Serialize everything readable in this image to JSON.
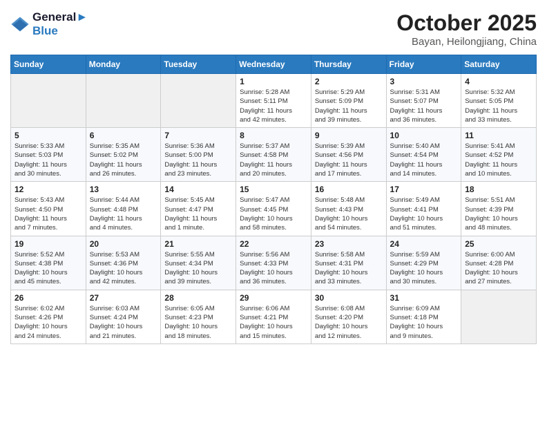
{
  "logo": {
    "line1": "General",
    "line2": "Blue"
  },
  "title": "October 2025",
  "subtitle": "Bayan, Heilongjiang, China",
  "days_header": [
    "Sunday",
    "Monday",
    "Tuesday",
    "Wednesday",
    "Thursday",
    "Friday",
    "Saturday"
  ],
  "weeks": [
    [
      {
        "day": "",
        "info": ""
      },
      {
        "day": "",
        "info": ""
      },
      {
        "day": "",
        "info": ""
      },
      {
        "day": "1",
        "info": "Sunrise: 5:28 AM\nSunset: 5:11 PM\nDaylight: 11 hours\nand 42 minutes."
      },
      {
        "day": "2",
        "info": "Sunrise: 5:29 AM\nSunset: 5:09 PM\nDaylight: 11 hours\nand 39 minutes."
      },
      {
        "day": "3",
        "info": "Sunrise: 5:31 AM\nSunset: 5:07 PM\nDaylight: 11 hours\nand 36 minutes."
      },
      {
        "day": "4",
        "info": "Sunrise: 5:32 AM\nSunset: 5:05 PM\nDaylight: 11 hours\nand 33 minutes."
      }
    ],
    [
      {
        "day": "5",
        "info": "Sunrise: 5:33 AM\nSunset: 5:03 PM\nDaylight: 11 hours\nand 30 minutes."
      },
      {
        "day": "6",
        "info": "Sunrise: 5:35 AM\nSunset: 5:02 PM\nDaylight: 11 hours\nand 26 minutes."
      },
      {
        "day": "7",
        "info": "Sunrise: 5:36 AM\nSunset: 5:00 PM\nDaylight: 11 hours\nand 23 minutes."
      },
      {
        "day": "8",
        "info": "Sunrise: 5:37 AM\nSunset: 4:58 PM\nDaylight: 11 hours\nand 20 minutes."
      },
      {
        "day": "9",
        "info": "Sunrise: 5:39 AM\nSunset: 4:56 PM\nDaylight: 11 hours\nand 17 minutes."
      },
      {
        "day": "10",
        "info": "Sunrise: 5:40 AM\nSunset: 4:54 PM\nDaylight: 11 hours\nand 14 minutes."
      },
      {
        "day": "11",
        "info": "Sunrise: 5:41 AM\nSunset: 4:52 PM\nDaylight: 11 hours\nand 10 minutes."
      }
    ],
    [
      {
        "day": "12",
        "info": "Sunrise: 5:43 AM\nSunset: 4:50 PM\nDaylight: 11 hours\nand 7 minutes."
      },
      {
        "day": "13",
        "info": "Sunrise: 5:44 AM\nSunset: 4:48 PM\nDaylight: 11 hours\nand 4 minutes."
      },
      {
        "day": "14",
        "info": "Sunrise: 5:45 AM\nSunset: 4:47 PM\nDaylight: 11 hours\nand 1 minute."
      },
      {
        "day": "15",
        "info": "Sunrise: 5:47 AM\nSunset: 4:45 PM\nDaylight: 10 hours\nand 58 minutes."
      },
      {
        "day": "16",
        "info": "Sunrise: 5:48 AM\nSunset: 4:43 PM\nDaylight: 10 hours\nand 54 minutes."
      },
      {
        "day": "17",
        "info": "Sunrise: 5:49 AM\nSunset: 4:41 PM\nDaylight: 10 hours\nand 51 minutes."
      },
      {
        "day": "18",
        "info": "Sunrise: 5:51 AM\nSunset: 4:39 PM\nDaylight: 10 hours\nand 48 minutes."
      }
    ],
    [
      {
        "day": "19",
        "info": "Sunrise: 5:52 AM\nSunset: 4:38 PM\nDaylight: 10 hours\nand 45 minutes."
      },
      {
        "day": "20",
        "info": "Sunrise: 5:53 AM\nSunset: 4:36 PM\nDaylight: 10 hours\nand 42 minutes."
      },
      {
        "day": "21",
        "info": "Sunrise: 5:55 AM\nSunset: 4:34 PM\nDaylight: 10 hours\nand 39 minutes."
      },
      {
        "day": "22",
        "info": "Sunrise: 5:56 AM\nSunset: 4:33 PM\nDaylight: 10 hours\nand 36 minutes."
      },
      {
        "day": "23",
        "info": "Sunrise: 5:58 AM\nSunset: 4:31 PM\nDaylight: 10 hours\nand 33 minutes."
      },
      {
        "day": "24",
        "info": "Sunrise: 5:59 AM\nSunset: 4:29 PM\nDaylight: 10 hours\nand 30 minutes."
      },
      {
        "day": "25",
        "info": "Sunrise: 6:00 AM\nSunset: 4:28 PM\nDaylight: 10 hours\nand 27 minutes."
      }
    ],
    [
      {
        "day": "26",
        "info": "Sunrise: 6:02 AM\nSunset: 4:26 PM\nDaylight: 10 hours\nand 24 minutes."
      },
      {
        "day": "27",
        "info": "Sunrise: 6:03 AM\nSunset: 4:24 PM\nDaylight: 10 hours\nand 21 minutes."
      },
      {
        "day": "28",
        "info": "Sunrise: 6:05 AM\nSunset: 4:23 PM\nDaylight: 10 hours\nand 18 minutes."
      },
      {
        "day": "29",
        "info": "Sunrise: 6:06 AM\nSunset: 4:21 PM\nDaylight: 10 hours\nand 15 minutes."
      },
      {
        "day": "30",
        "info": "Sunrise: 6:08 AM\nSunset: 4:20 PM\nDaylight: 10 hours\nand 12 minutes."
      },
      {
        "day": "31",
        "info": "Sunrise: 6:09 AM\nSunset: 4:18 PM\nDaylight: 10 hours\nand 9 minutes."
      },
      {
        "day": "",
        "info": ""
      }
    ]
  ]
}
